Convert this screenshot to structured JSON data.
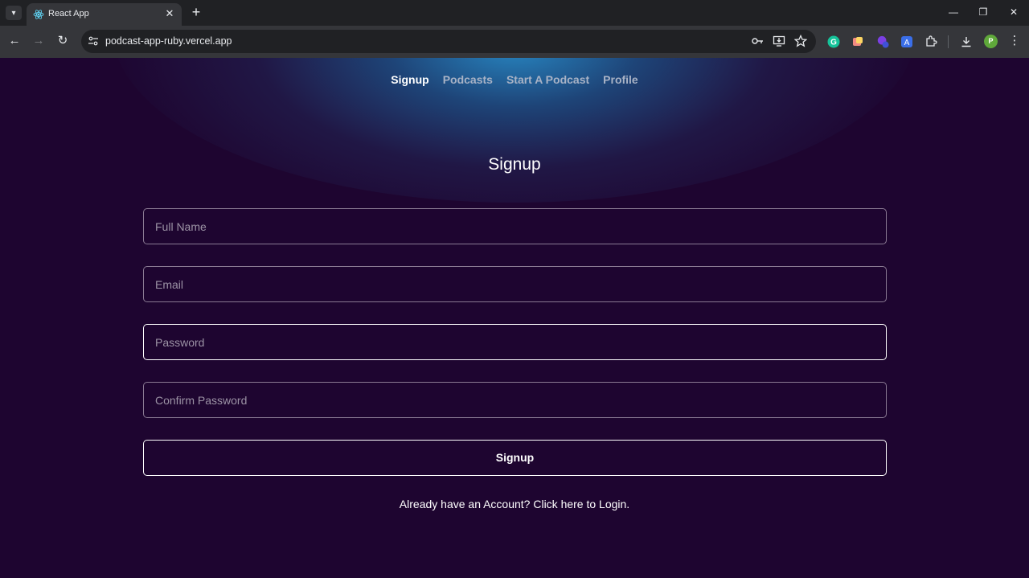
{
  "browser": {
    "tab_title": "React App",
    "url": "podcast-app-ruby.vercel.app",
    "profile_initial": "P",
    "extension_badge": "4"
  },
  "nav": {
    "links": [
      "Signup",
      "Podcasts",
      "Start A Podcast",
      "Profile"
    ],
    "active": "Signup"
  },
  "form": {
    "heading": "Signup",
    "full_name_placeholder": "Full Name",
    "email_placeholder": "Email",
    "password_placeholder": "Password",
    "confirm_password_placeholder": "Confirm Password",
    "submit_label": "Signup",
    "login_prompt": "Already have an Account? Click here to Login."
  },
  "colors": {
    "background": "#1e0530",
    "glow": "#288cc8",
    "input_border": "#8a7a93",
    "focused_border": "#ffffff",
    "nav_inactive": "#a9b3c6"
  }
}
